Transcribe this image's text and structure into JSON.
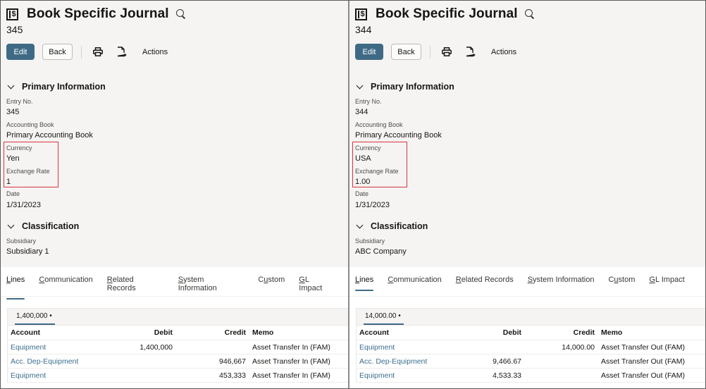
{
  "panels": [
    {
      "title": "Book Specific Journal",
      "record_icon": "journal-dollar-icon",
      "record_number": "345",
      "toolbar": {
        "edit_label": "Edit",
        "back_label": "Back",
        "print_icon": "printer-icon",
        "new_doc_icon": "new-document-icon",
        "actions_label": "Actions"
      },
      "primary_section": {
        "title": "Primary Information",
        "fields": [
          {
            "label": "Entry No.",
            "value": "345"
          },
          {
            "label": "Accounting Book",
            "value": "Primary Accounting Book"
          },
          {
            "label": "Currency",
            "value": "Yen"
          },
          {
            "label": "Exchange Rate",
            "value": "1"
          },
          {
            "label": "Date",
            "value": "1/31/2023"
          }
        ]
      },
      "classification_section": {
        "title": "Classification",
        "fields": [
          {
            "label": "Subsidiary",
            "value": "Subsidiary 1"
          }
        ]
      },
      "tabs": [
        {
          "pre": "",
          "u": "L",
          "post": "ines",
          "active": true
        },
        {
          "pre": "",
          "u": "C",
          "post": "ommunication"
        },
        {
          "pre": "",
          "u": "R",
          "post": "elated Records"
        },
        {
          "pre": "",
          "u": "S",
          "post": "ystem Information"
        },
        {
          "pre": "C",
          "u": "u",
          "post": "stom"
        },
        {
          "pre": "",
          "u": "G",
          "post": "L Impact"
        }
      ],
      "lines": {
        "total": "1,400,000 •",
        "columns": {
          "account": "Account",
          "debit": "Debit",
          "credit": "Credit",
          "memo": "Memo"
        },
        "rows": [
          {
            "account": "Equipment",
            "debit": "1,400,000",
            "credit": "",
            "memo": "Asset Transfer In (FAM)"
          },
          {
            "account": "Acc. Dep-Equipment",
            "debit": "",
            "credit": "946,667",
            "memo": "Asset Transfer In (FAM)"
          },
          {
            "account": "Equipment",
            "debit": "",
            "credit": "453,333",
            "memo": "Asset Transfer In (FAM)"
          }
        ]
      }
    },
    {
      "title": "Book Specific Journal",
      "record_icon": "journal-dollar-icon",
      "record_number": "344",
      "toolbar": {
        "edit_label": "Edit",
        "back_label": "Back",
        "print_icon": "printer-icon",
        "new_doc_icon": "new-document-icon",
        "actions_label": "Actions"
      },
      "primary_section": {
        "title": "Primary Information",
        "fields": [
          {
            "label": "Entry No.",
            "value": "344"
          },
          {
            "label": "Accounting Book",
            "value": "Primary Accounting Book"
          },
          {
            "label": "Currency",
            "value": "USA"
          },
          {
            "label": "Exchange Rate",
            "value": "1.00"
          },
          {
            "label": "Date",
            "value": "1/31/2023"
          }
        ]
      },
      "classification_section": {
        "title": "Classification",
        "fields": [
          {
            "label": "Subsidiary",
            "value": "ABC Company"
          }
        ]
      },
      "tabs": [
        {
          "pre": "",
          "u": "L",
          "post": "ines",
          "active": true
        },
        {
          "pre": "",
          "u": "C",
          "post": "ommunication"
        },
        {
          "pre": "",
          "u": "R",
          "post": "elated Records"
        },
        {
          "pre": "",
          "u": "S",
          "post": "ystem Information"
        },
        {
          "pre": "C",
          "u": "u",
          "post": "stom"
        },
        {
          "pre": "",
          "u": "G",
          "post": "L Impact"
        }
      ],
      "lines": {
        "total": "14,000.00 •",
        "columns": {
          "account": "Account",
          "debit": "Debit",
          "credit": "Credit",
          "memo": "Memo"
        },
        "rows": [
          {
            "account": "Equipment",
            "debit": "",
            "credit": "14,000.00",
            "memo": "Asset Transfer Out (FAM)"
          },
          {
            "account": "Acc. Dep-Equipment",
            "debit": "9,466.67",
            "credit": "",
            "memo": "Asset Transfer Out (FAM)"
          },
          {
            "account": "Equipment",
            "debit": "4,533.33",
            "credit": "",
            "memo": "Asset Transfer Out (FAM)"
          }
        ]
      }
    }
  ],
  "colors": {
    "accent": "#3f6a85",
    "link": "#3c6e8f",
    "highlight": "#d9333f",
    "header_bg": "#f5f4f2"
  }
}
